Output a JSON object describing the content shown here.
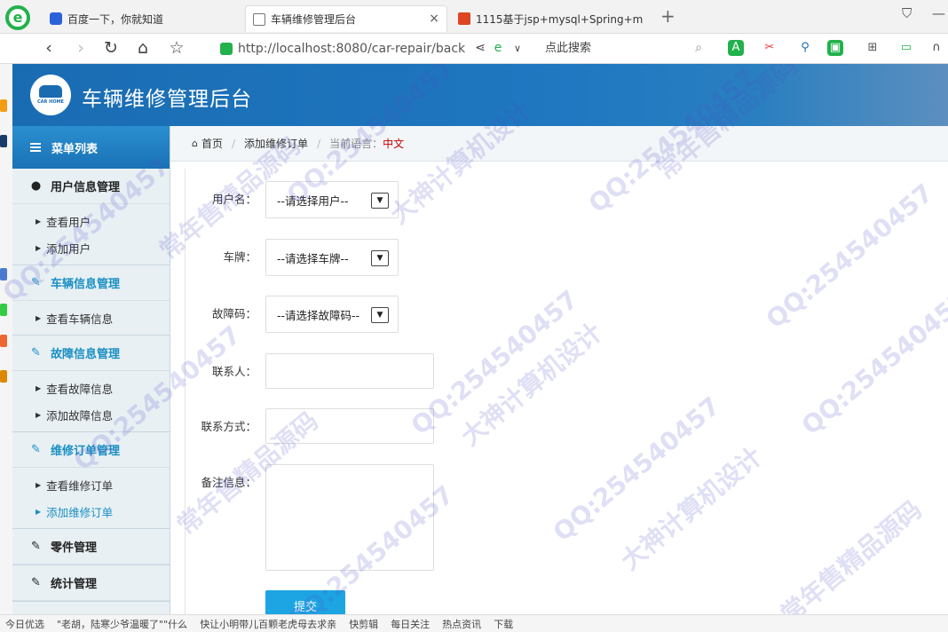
{
  "browser": {
    "tabs": [
      {
        "title": "百度一下，你就知道"
      },
      {
        "title": "车辆维修管理后台",
        "close": "×"
      },
      {
        "title": "1115基于jsp+mysql+Spring+m"
      }
    ],
    "new_tab": "+",
    "url": "http://localhost:8080/car-repair/back",
    "search_placeholder": "点此搜索",
    "win_buttons": [
      "⛉",
      "—"
    ]
  },
  "app": {
    "title": "车辆维修管理后台",
    "logo_text": "CAR HOME"
  },
  "menu": {
    "header": "菜单列表",
    "groups": [
      {
        "label": "用户信息管理",
        "icon": "user-icon",
        "items": [
          "查看用户",
          "添加用户"
        ]
      },
      {
        "label": "车辆信息管理",
        "icon": "edit-icon",
        "items": [
          "查看车辆信息"
        ]
      },
      {
        "label": "故障信息管理",
        "icon": "edit-icon",
        "items": [
          "查看故障信息",
          "添加故障信息"
        ]
      },
      {
        "label": "维修订单管理",
        "icon": "edit-icon",
        "items": [
          "查看维修订单",
          "添加维修订单"
        ]
      },
      {
        "label": "零件管理",
        "icon": "edit-icon",
        "items": []
      },
      {
        "label": "统计管理",
        "icon": "edit-icon",
        "items": []
      }
    ]
  },
  "breadcrumb": {
    "home": "首页",
    "current": "添加维修订单",
    "lang_label": "当前语言：",
    "lang_value": "中文"
  },
  "form": {
    "user_label": "用户名：",
    "user_value": "--请选择用户--",
    "plate_label": "车牌：",
    "plate_value": "--请选择车牌--",
    "fault_label": "故障码：",
    "fault_value": "--请选择故障码--",
    "contact_label": "联系人：",
    "phone_label": "联系方式：",
    "note_label": "备注信息：",
    "submit": "提交"
  },
  "statusbar": {
    "items": [
      "今日优选",
      "\"老胡，陆寒少爷温暖了\"\"什么",
      "快让小明带儿百颗老虎母去求亲",
      "快剪辑",
      "每日关注",
      "热点资讯",
      "下载"
    ]
  },
  "watermark": {
    "texts": [
      "QQ:254540457",
      "常年售精品源码",
      "大神计算机设计"
    ]
  }
}
